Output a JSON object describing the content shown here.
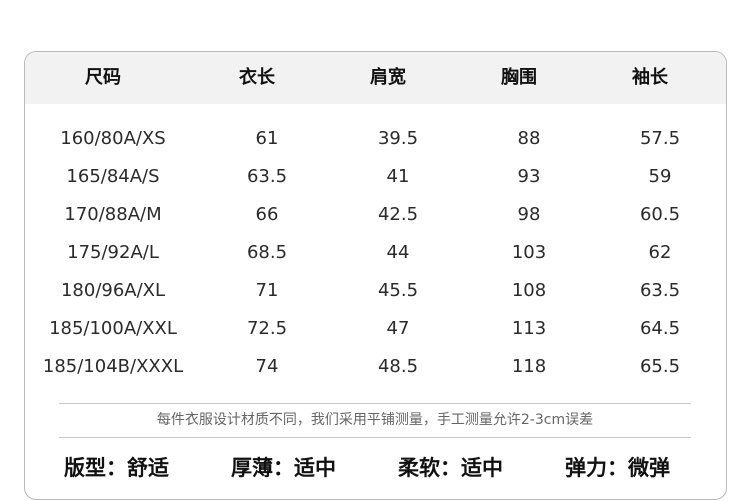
{
  "table": {
    "headers": [
      "尺码",
      "衣长",
      "肩宽",
      "胸围",
      "袖长"
    ],
    "rows": [
      [
        "160/80A/XS",
        "61",
        "39.5",
        "88",
        "57.5"
      ],
      [
        "165/84A/S",
        "63.5",
        "41",
        "93",
        "59"
      ],
      [
        "170/88A/M",
        "66",
        "42.5",
        "98",
        "60.5"
      ],
      [
        "175/92A/L",
        "68.5",
        "44",
        "103",
        "62"
      ],
      [
        "180/96A/XL",
        "71",
        "45.5",
        "108",
        "63.5"
      ],
      [
        "185/100A/XXL",
        "72.5",
        "47",
        "113",
        "64.5"
      ],
      [
        "185/104B/XXXL",
        "74",
        "48.5",
        "118",
        "65.5"
      ]
    ]
  },
  "note": "每件衣服设计材质不同，我们采用平铺测量，手工测量允许2-3cm误差",
  "attributes": [
    "版型：舒适",
    "厚薄：适中",
    "柔软：适中",
    "弹力：微弹"
  ]
}
